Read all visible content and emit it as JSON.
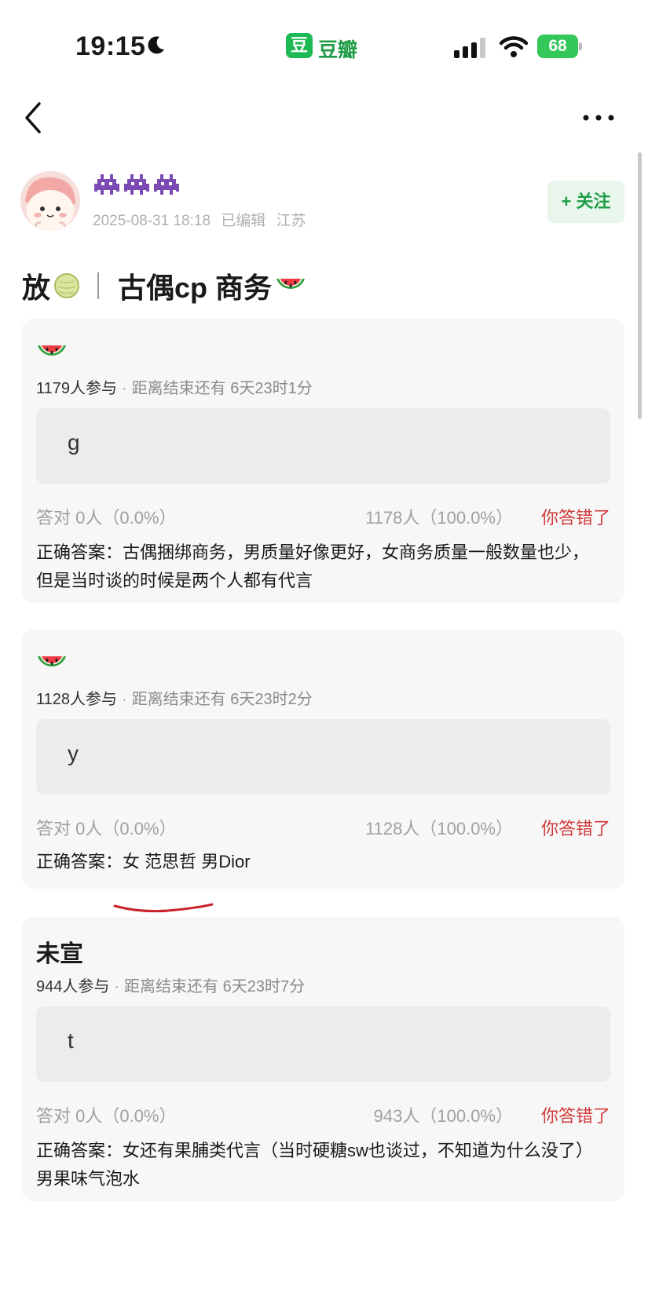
{
  "status_bar": {
    "time": "19:15",
    "app_badge": "豆",
    "app_name": "豆瓣",
    "battery": "68"
  },
  "post": {
    "meta": {
      "date": "2025-08-31 18:18",
      "edited": "已编辑",
      "location": "江苏"
    },
    "follow_label": "+ 关注",
    "title_prefix": "放",
    "title_main": "古偶cp 商务"
  },
  "polls": [
    {
      "heading": "",
      "participants": "1179人参与",
      "deadline": "距离结束还有 6天23时1分",
      "option": "g",
      "correct_stat": "答对 0人（0.0%）",
      "wrong_stat": "1178人（100.0%）",
      "verdict": "你答错了",
      "answer": "正确答案：古偶捆绑商务，男质量好像更好，女商务质量一般数量也少，但是当时谈的时候是两个人都有代言"
    },
    {
      "heading": "",
      "participants": "1128人参与",
      "deadline": "距离结束还有 6天23时2分",
      "option": "y",
      "correct_stat": "答对 0人（0.0%）",
      "wrong_stat": "1128人（100.0%）",
      "verdict": "你答错了",
      "answer": "正确答案：女 范思哲 男Dior"
    },
    {
      "heading": "未宣",
      "participants": "944人参与",
      "deadline": "距离结束还有 6天23时7分",
      "option": "t",
      "correct_stat": "答对 0人（0.0%）",
      "wrong_stat": "943人（100.0%）",
      "verdict": "你答错了",
      "answer": "正确答案：女还有果脯类代言（当时硬糖sw也谈过，不知道为什么没了） 男果味气泡水"
    }
  ],
  "colors": {
    "accent_green": "#1f9d46",
    "wrong_red": "#d23b3b",
    "card_bg": "#f7f7f7"
  },
  "icons": [
    "back-icon",
    "more-icon",
    "moon-icon",
    "signal-icon",
    "wifi-icon",
    "alien-icon",
    "melon-icon",
    "watermelon-icon"
  ]
}
